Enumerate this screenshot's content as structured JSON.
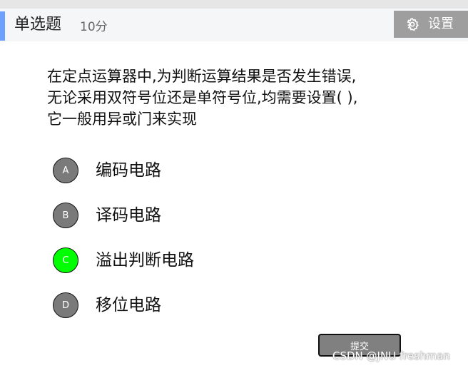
{
  "header": {
    "question_type": "单选题",
    "score": "10分",
    "settings_label": "设置"
  },
  "question": {
    "lines": [
      "在定点运算器中,为判断运算结果是否发生错误,",
      "无论采用双符号位还是单符号位,均需要设置(  ),",
      "它一般用异或门来实现"
    ]
  },
  "options": [
    {
      "letter": "A",
      "text": "编码电路",
      "selected": false
    },
    {
      "letter": "B",
      "text": "译码电路",
      "selected": false
    },
    {
      "letter": "C",
      "text": "溢出判断电路",
      "selected": true
    },
    {
      "letter": "D",
      "text": "移位电路",
      "selected": false
    }
  ],
  "submit_label": "提交",
  "watermark": "CSDN @JNU freshman",
  "colors": {
    "accent": "#6ea0ff",
    "selected": "#00ff00",
    "unselected": "#7a7a7a",
    "settings_bg": "#9e9e9e"
  }
}
